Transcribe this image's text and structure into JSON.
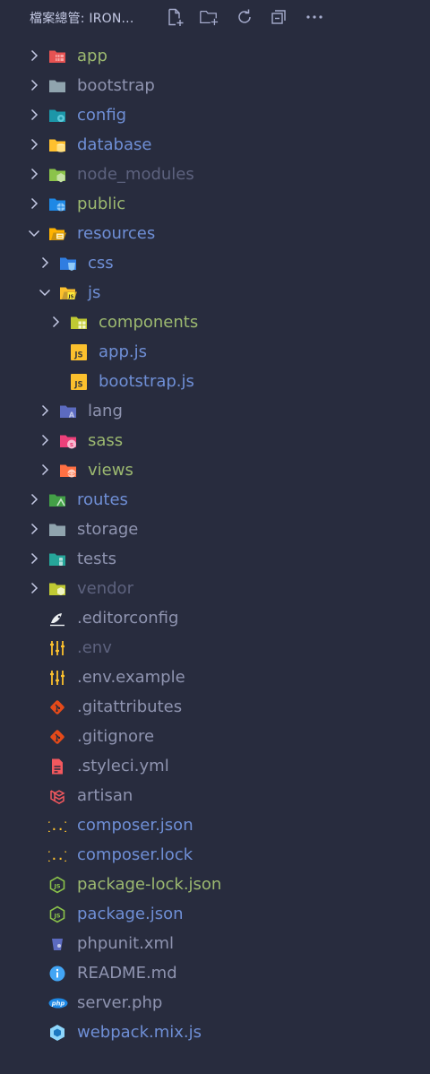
{
  "header": {
    "title": "檔案總管: IRON...",
    "actions": [
      {
        "name": "new-file-icon"
      },
      {
        "name": "new-folder-icon"
      },
      {
        "name": "refresh-icon"
      },
      {
        "name": "collapse-all-icon"
      },
      {
        "name": "more-icon"
      }
    ]
  },
  "colors": {
    "background": "#282c3e",
    "green_label": "#9cb970",
    "blue_label": "#6f8fd6",
    "grey_label": "#8f94b0",
    "dim_label": "#5d627e"
  },
  "tree": [
    {
      "label": "app",
      "depth": 0,
      "chevron": "right",
      "icon": "folder-app-icon",
      "tone": "green"
    },
    {
      "label": "bootstrap",
      "depth": 0,
      "chevron": "right",
      "icon": "folder-plain-icon",
      "tone": "grey"
    },
    {
      "label": "config",
      "depth": 0,
      "chevron": "right",
      "icon": "folder-config-icon",
      "tone": "blue"
    },
    {
      "label": "database",
      "depth": 0,
      "chevron": "right",
      "icon": "folder-database-icon",
      "tone": "blue"
    },
    {
      "label": "node_modules",
      "depth": 0,
      "chevron": "right",
      "icon": "folder-node-icon",
      "tone": "dim"
    },
    {
      "label": "public",
      "depth": 0,
      "chevron": "right",
      "icon": "folder-public-icon",
      "tone": "green"
    },
    {
      "label": "resources",
      "depth": 0,
      "chevron": "down",
      "icon": "folder-resources-open-icon",
      "tone": "blue"
    },
    {
      "label": "css",
      "depth": 1,
      "chevron": "right",
      "icon": "folder-css-icon",
      "tone": "blue"
    },
    {
      "label": "js",
      "depth": 1,
      "chevron": "down",
      "icon": "folder-js-open-icon",
      "tone": "blue"
    },
    {
      "label": "components",
      "depth": 2,
      "chevron": "right",
      "icon": "folder-components-icon",
      "tone": "green"
    },
    {
      "label": "app.js",
      "depth": 2,
      "chevron": "none",
      "icon": "js-file-icon",
      "tone": "blue"
    },
    {
      "label": "bootstrap.js",
      "depth": 2,
      "chevron": "none",
      "icon": "js-file-icon",
      "tone": "blue"
    },
    {
      "label": "lang",
      "depth": 1,
      "chevron": "right",
      "icon": "folder-lang-icon",
      "tone": "grey"
    },
    {
      "label": "sass",
      "depth": 1,
      "chevron": "right",
      "icon": "folder-sass-icon",
      "tone": "green"
    },
    {
      "label": "views",
      "depth": 1,
      "chevron": "right",
      "icon": "folder-views-icon",
      "tone": "green"
    },
    {
      "label": "routes",
      "depth": 0,
      "chevron": "right",
      "icon": "folder-routes-icon",
      "tone": "blue"
    },
    {
      "label": "storage",
      "depth": 0,
      "chevron": "right",
      "icon": "folder-plain-icon",
      "tone": "grey"
    },
    {
      "label": "tests",
      "depth": 0,
      "chevron": "right",
      "icon": "folder-tests-icon",
      "tone": "grey"
    },
    {
      "label": "vendor",
      "depth": 0,
      "chevron": "right",
      "icon": "folder-vendor-icon",
      "tone": "dim"
    },
    {
      "label": ".editorconfig",
      "depth": 0,
      "chevron": "none",
      "icon": "editorconfig-icon",
      "tone": "grey"
    },
    {
      "label": ".env",
      "depth": 0,
      "chevron": "none",
      "icon": "env-tune-icon",
      "tone": "dim"
    },
    {
      "label": ".env.example",
      "depth": 0,
      "chevron": "none",
      "icon": "env-tune-icon",
      "tone": "grey"
    },
    {
      "label": ".gitattributes",
      "depth": 0,
      "chevron": "none",
      "icon": "git-icon",
      "tone": "grey"
    },
    {
      "label": ".gitignore",
      "depth": 0,
      "chevron": "none",
      "icon": "git-icon",
      "tone": "grey"
    },
    {
      "label": ".styleci.yml",
      "depth": 0,
      "chevron": "none",
      "icon": "yaml-file-icon",
      "tone": "grey"
    },
    {
      "label": "artisan",
      "depth": 0,
      "chevron": "none",
      "icon": "laravel-icon",
      "tone": "grey"
    },
    {
      "label": "composer.json",
      "depth": 0,
      "chevron": "none",
      "icon": "json-braces-icon",
      "tone": "blue"
    },
    {
      "label": "composer.lock",
      "depth": 0,
      "chevron": "none",
      "icon": "json-braces-icon",
      "tone": "blue"
    },
    {
      "label": "package-lock.json",
      "depth": 0,
      "chevron": "none",
      "icon": "nodejs-icon",
      "tone": "green"
    },
    {
      "label": "package.json",
      "depth": 0,
      "chevron": "none",
      "icon": "nodejs-icon",
      "tone": "blue"
    },
    {
      "label": "phpunit.xml",
      "depth": 0,
      "chevron": "none",
      "icon": "phpunit-icon",
      "tone": "grey"
    },
    {
      "label": "README.md",
      "depth": 0,
      "chevron": "none",
      "icon": "info-icon",
      "tone": "grey"
    },
    {
      "label": "server.php",
      "depth": 0,
      "chevron": "none",
      "icon": "php-icon",
      "tone": "grey"
    },
    {
      "label": "webpack.mix.js",
      "depth": 0,
      "chevron": "none",
      "icon": "webpack-icon",
      "tone": "blue"
    }
  ]
}
